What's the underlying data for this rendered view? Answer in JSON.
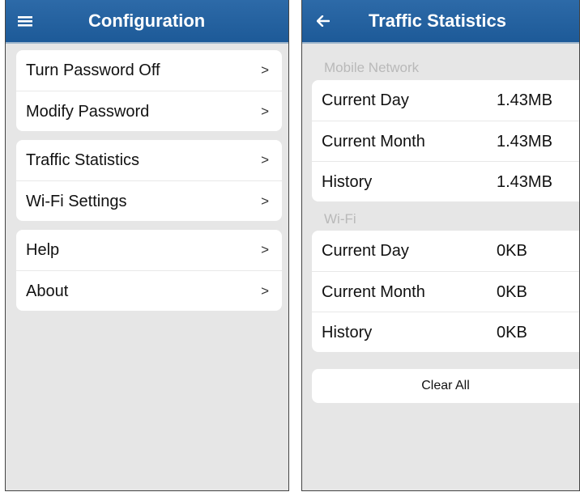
{
  "config_screen": {
    "title": "Configuration",
    "groups": [
      {
        "items": [
          {
            "label": "Turn Password Off"
          },
          {
            "label": "Modify Password"
          }
        ]
      },
      {
        "items": [
          {
            "label": "Traffic Statistics"
          },
          {
            "label": "Wi-Fi Settings"
          }
        ]
      },
      {
        "items": [
          {
            "label": "Help"
          },
          {
            "label": "About"
          }
        ]
      }
    ],
    "chevron": ">"
  },
  "traffic_screen": {
    "title": "Traffic Statistics",
    "mobile": {
      "heading": "Mobile Network",
      "rows": [
        {
          "label": "Current Day",
          "value": "1.43MB"
        },
        {
          "label": "Current Month",
          "value": "1.43MB"
        },
        {
          "label": "History",
          "value": "1.43MB"
        }
      ]
    },
    "wifi": {
      "heading": "Wi-Fi",
      "rows": [
        {
          "label": "Current Day",
          "value": "0KB"
        },
        {
          "label": "Current Month",
          "value": "0KB"
        },
        {
          "label": "History",
          "value": "0KB"
        }
      ]
    },
    "clear_label": "Clear All"
  },
  "icons": {
    "menu": "hamburger-menu-icon",
    "back": "back-arrow-icon"
  },
  "colors": {
    "app_bar": "#2d6aa8",
    "background": "#e6e6e6",
    "section_heading": "#b9b9b9"
  }
}
